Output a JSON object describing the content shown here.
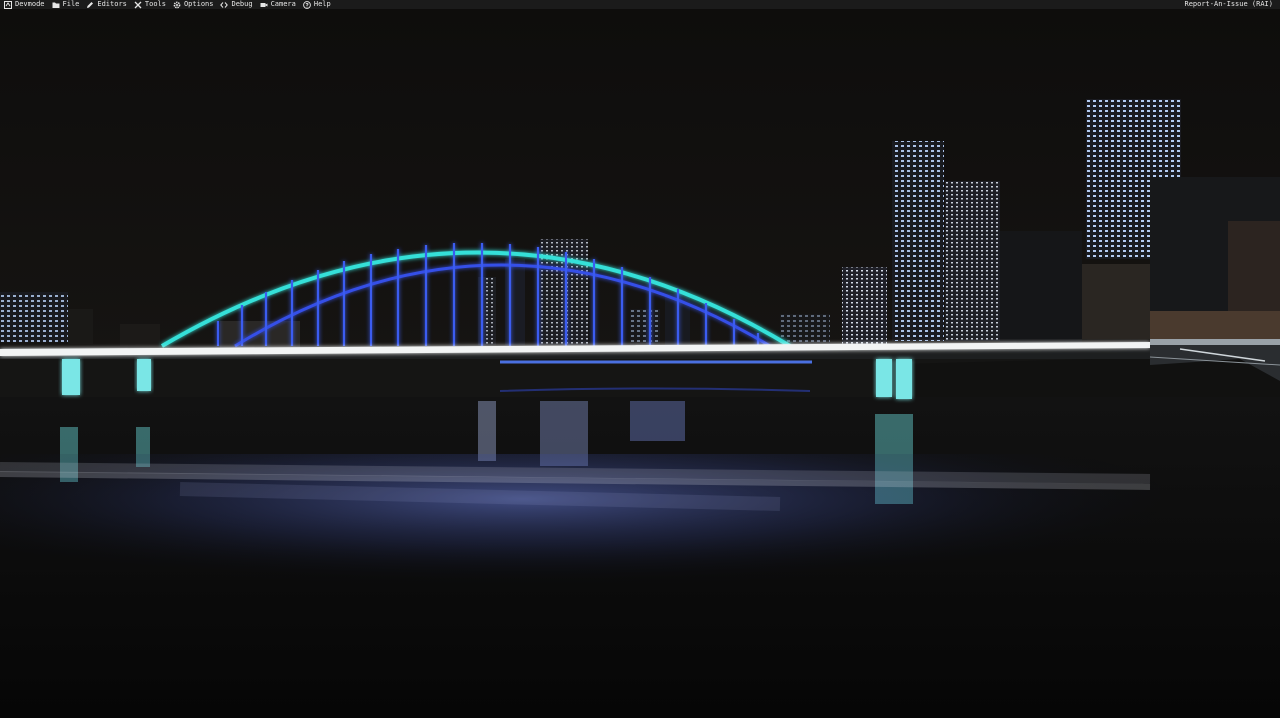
{
  "menubar": {
    "items": [
      {
        "label": "Devmode",
        "icon": "devmode-icon"
      },
      {
        "label": "File",
        "icon": "folder-icon"
      },
      {
        "label": "Editors",
        "icon": "pencil-icon"
      },
      {
        "label": "Tools",
        "icon": "tools-icon"
      },
      {
        "label": "Options",
        "icon": "gear-icon"
      },
      {
        "label": "Debug",
        "icon": "code-brackets-icon"
      },
      {
        "label": "Camera",
        "icon": "camera-icon"
      },
      {
        "label": "Help",
        "icon": "help-circle-icon"
      }
    ],
    "report_label": "Report-An-Issue (RAI)"
  },
  "colors": {
    "menubar_bg": "#1b1b1b",
    "menubar_text": "#e6e6e6",
    "sky": "#0f0e0d",
    "arch_outer": "#35e0d8",
    "arch_inner": "#3550e8",
    "deck_light": "#f2f4f4",
    "pier_light": "#7ae6e6",
    "water": "#080808"
  }
}
